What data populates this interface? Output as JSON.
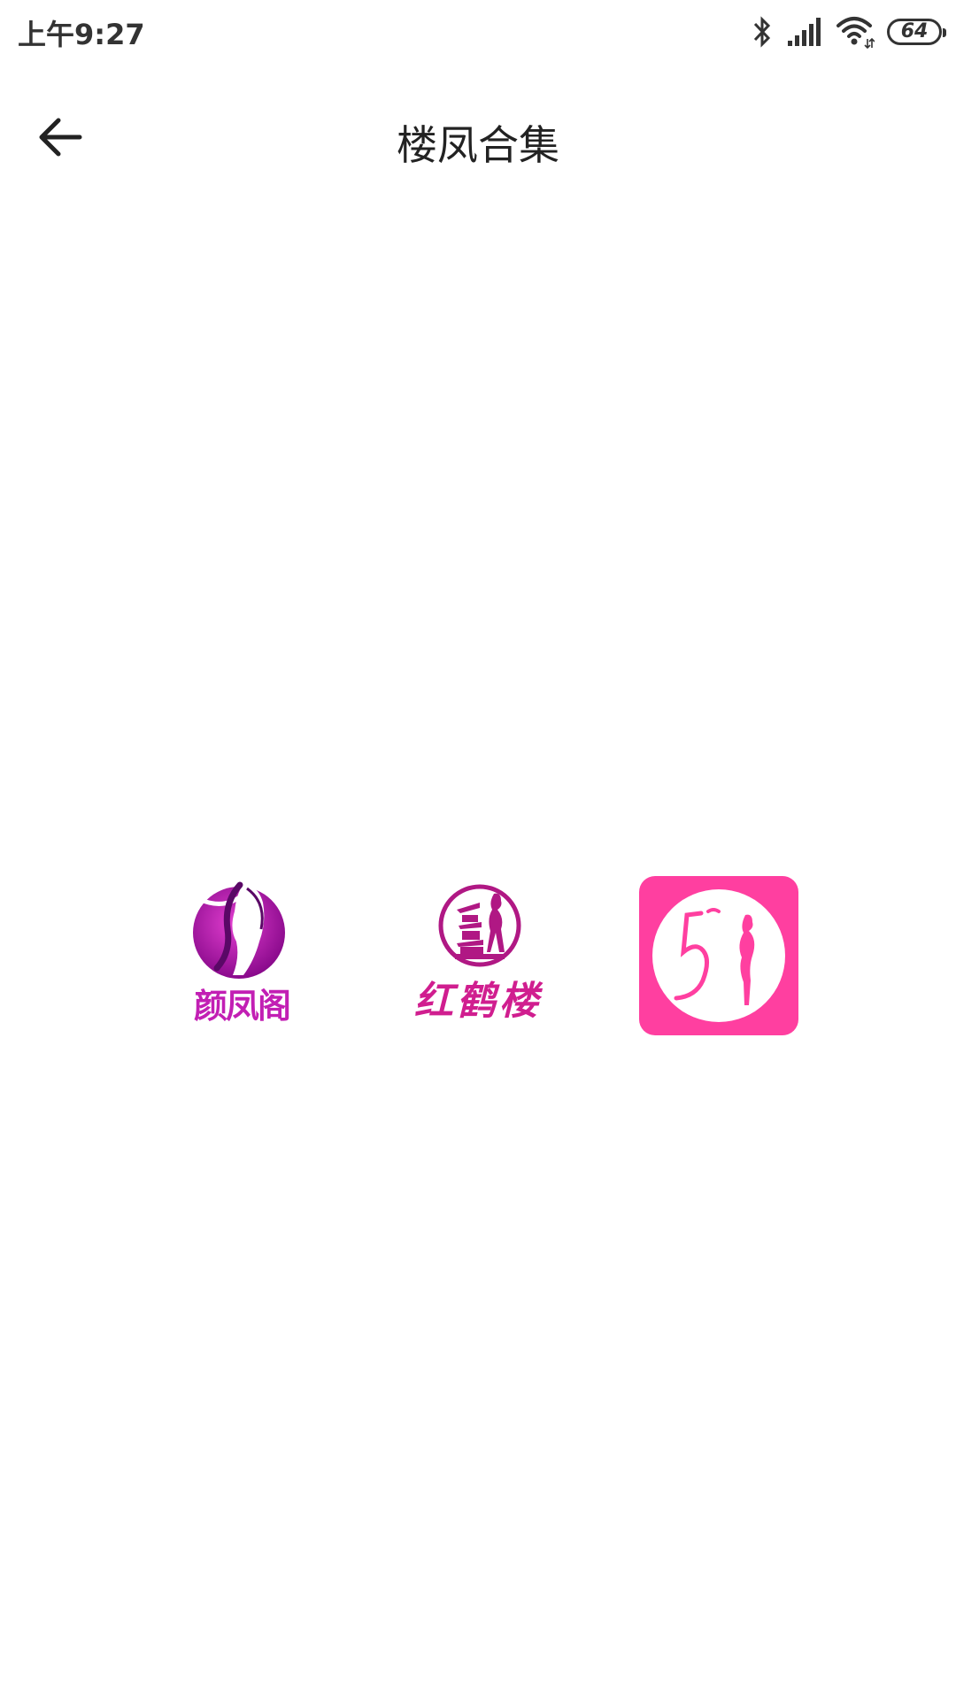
{
  "status_bar": {
    "time": "上午9:27",
    "battery_level": "64",
    "icons": [
      "bluetooth-icon",
      "cellular-signal-icon",
      "wifi-icon",
      "battery-icon"
    ]
  },
  "header": {
    "title": "楼凤合集",
    "back_icon": "arrow-left-icon"
  },
  "apps": [
    {
      "label": "颜凤阁",
      "icon": "yanfengge-logo",
      "color": "#c21fb4"
    },
    {
      "label": "红鹤楼",
      "icon": "hongheleou-logo",
      "color": "#d01e8f"
    },
    {
      "label": "51",
      "icon": "app-51-logo",
      "color": "#ff3fa0"
    }
  ],
  "colors": {
    "background": "#ffffff",
    "text": "#222222",
    "accent_pink": "#ff3fa0",
    "accent_purple": "#a0109c"
  }
}
